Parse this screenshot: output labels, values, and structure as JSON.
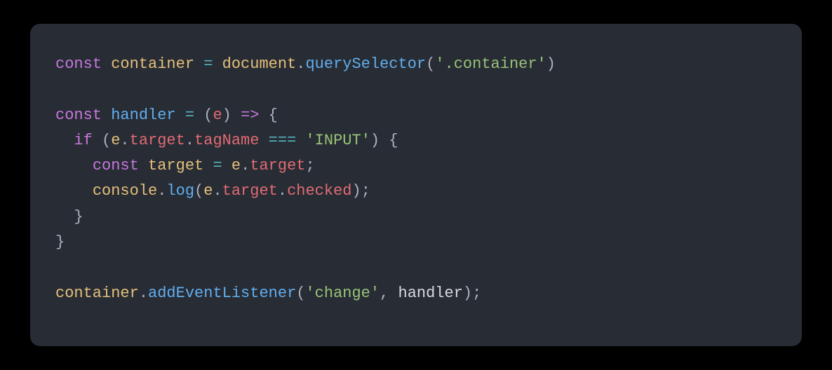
{
  "code": {
    "line1": {
      "t1": "const",
      "t2": " ",
      "t3": "container",
      "t4": " ",
      "t5": "=",
      "t6": " ",
      "t7": "document",
      "t8": ".",
      "t9": "querySelector",
      "t10": "(",
      "t11": "'.container'",
      "t12": ")"
    },
    "line3": {
      "t1": "const",
      "t2": " ",
      "t3": "handler",
      "t4": " ",
      "t5": "=",
      "t6": " ",
      "t7": "(",
      "t8": "e",
      "t9": ")",
      "t10": " ",
      "t11": "=>",
      "t12": " ",
      "t13": "{"
    },
    "line4": {
      "t1": "  ",
      "t2": "if",
      "t3": " ",
      "t4": "(",
      "t5": "e",
      "t6": ".",
      "t7": "target",
      "t8": ".",
      "t9": "tagName",
      "t10": " ",
      "t11": "===",
      "t12": " ",
      "t13": "'INPUT'",
      "t14": ")",
      "t15": " ",
      "t16": "{"
    },
    "line5": {
      "t1": "    ",
      "t2": "const",
      "t3": " ",
      "t4": "target",
      "t5": " ",
      "t6": "=",
      "t7": " ",
      "t8": "e",
      "t9": ".",
      "t10": "target",
      "t11": ";"
    },
    "line6": {
      "t1": "    ",
      "t2": "console",
      "t3": ".",
      "t4": "log",
      "t5": "(",
      "t6": "e",
      "t7": ".",
      "t8": "target",
      "t9": ".",
      "t10": "checked",
      "t11": ")",
      "t12": ";"
    },
    "line7": {
      "t1": "  ",
      "t2": "}"
    },
    "line8": {
      "t1": "}"
    },
    "line10": {
      "t1": "container",
      "t2": ".",
      "t3": "addEventListener",
      "t4": "(",
      "t5": "'change'",
      "t6": ",",
      "t7": " ",
      "t8": "handler",
      "t9": ")",
      "t10": ";"
    }
  }
}
